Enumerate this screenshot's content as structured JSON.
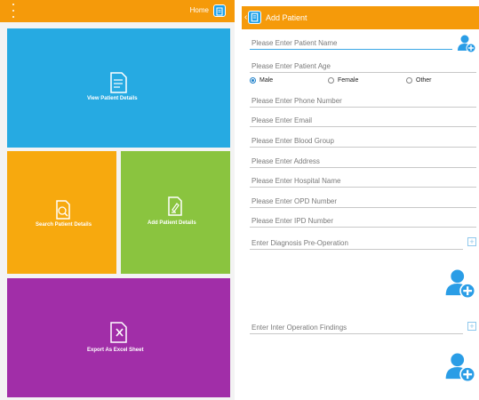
{
  "left": {
    "title": "Home",
    "tiles": {
      "view": {
        "label": "View Patient Details",
        "color": "#26aae2"
      },
      "search": {
        "label": "Search Patient Details",
        "color": "#f7a90e"
      },
      "add": {
        "label": "Add Patient Details",
        "color": "#8ac43f"
      },
      "export": {
        "label": "Export As Excel Sheet",
        "color": "#a12ea8"
      }
    }
  },
  "right": {
    "title": "Add Patient",
    "fields": {
      "name": "Please Enter Patient Name",
      "age": "Please Enter Patient Age",
      "phone": "Please Enter Phone Number",
      "email": "Please Enter Email",
      "blood": "Please Enter Blood Group",
      "address": "Please Enter Address",
      "hospital": "Please Enter Hospital Name",
      "opd": "Please Enter OPD Number",
      "ipd": "Please Enter IPD Number",
      "diagnosis": "Enter Diagnosis Pre-Operation",
      "findings": "Enter Inter Operation Findings"
    },
    "gender": {
      "options": [
        "Male",
        "Female",
        "Other"
      ],
      "selected": "Male"
    }
  },
  "colors": {
    "app_bar": "#f59a0a",
    "accent": "#1fa1e8"
  },
  "icons": [
    "more-vert-icon",
    "app-logo-icon",
    "back-chevron-icon",
    "document-icon",
    "search-document-icon",
    "add-document-icon",
    "excel-export-icon",
    "add-user-icon",
    "plus-icon"
  ]
}
